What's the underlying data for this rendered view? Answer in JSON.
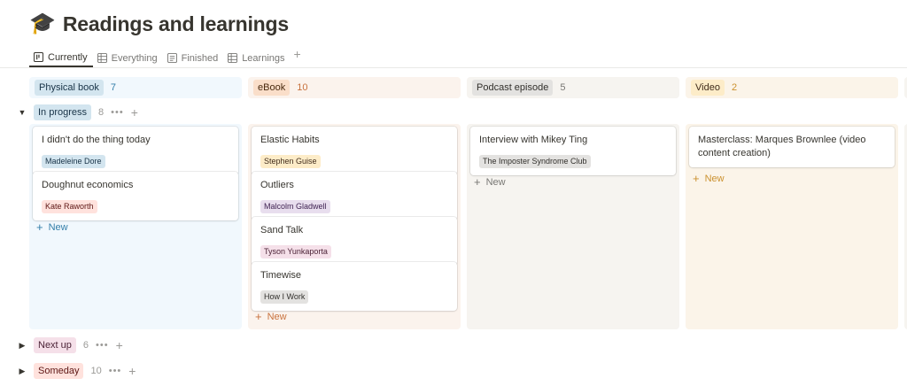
{
  "page": {
    "icon": "🎓",
    "title": "Readings and learnings"
  },
  "tabs": [
    {
      "label": "Currently",
      "icon": "board-icon",
      "active": true
    },
    {
      "label": "Everything",
      "icon": "table-icon"
    },
    {
      "label": "Finished",
      "icon": "list-icon"
    },
    {
      "label": "Learnings",
      "icon": "table-icon"
    }
  ],
  "columns": [
    {
      "label": "Physical book",
      "count": "7",
      "pill_bg": "#d3e5ef",
      "bg": "#f1f8fd",
      "count_color": "#337ea9"
    },
    {
      "label": "eBook",
      "count": "10",
      "pill_bg": "#fadec9",
      "bg": "#fbf3ed",
      "count_color": "#c8723e"
    },
    {
      "label": "Podcast episode",
      "count": "5",
      "pill_bg": "#e3e2e0",
      "bg": "#f6f4f0",
      "count_color": "#787774"
    },
    {
      "label": "Video",
      "count": "2",
      "pill_bg": "#fdecc8",
      "bg": "#fbf4e9",
      "count_color": "#cb912f"
    }
  ],
  "groups": [
    {
      "label": "In progress",
      "count": "8",
      "pill_bg": "#d3e5ef"
    },
    {
      "label": "Next up",
      "count": "6",
      "pill_bg": "#f5e0e9"
    },
    {
      "label": "Someday",
      "count": "10",
      "pill_bg": "#ffe2dd"
    }
  ],
  "new_label": "New",
  "cards": {
    "physical": [
      {
        "title": "I didn't do the thing today",
        "tag": "Madeleine Dore",
        "tag_bg": "#d3e5ef"
      },
      {
        "title": "Doughnut economics",
        "tag": "Kate Raworth",
        "tag_bg": "#ffe2dd"
      }
    ],
    "ebook": [
      {
        "title": "Elastic Habits",
        "tag": "Stephen Guise",
        "tag_bg": "#fdecc8"
      },
      {
        "title": "Outliers",
        "tag": "Malcolm Gladwell",
        "tag_bg": "#e8deee"
      },
      {
        "title": "Sand Talk",
        "tag": "Tyson Yunkaporta",
        "tag_bg": "#f5e0e9"
      },
      {
        "title": "Timewise",
        "tag": "How I Work",
        "tag_bg": "#e3e2e0"
      }
    ],
    "podcast": [
      {
        "title": "Interview with Mikey Ting",
        "tag": "The Imposter Syndrome Club",
        "tag_bg": "#e3e2e0"
      }
    ],
    "video": [
      {
        "title": "Masterclass: Marques Brownlee (video content creation)"
      }
    ]
  }
}
